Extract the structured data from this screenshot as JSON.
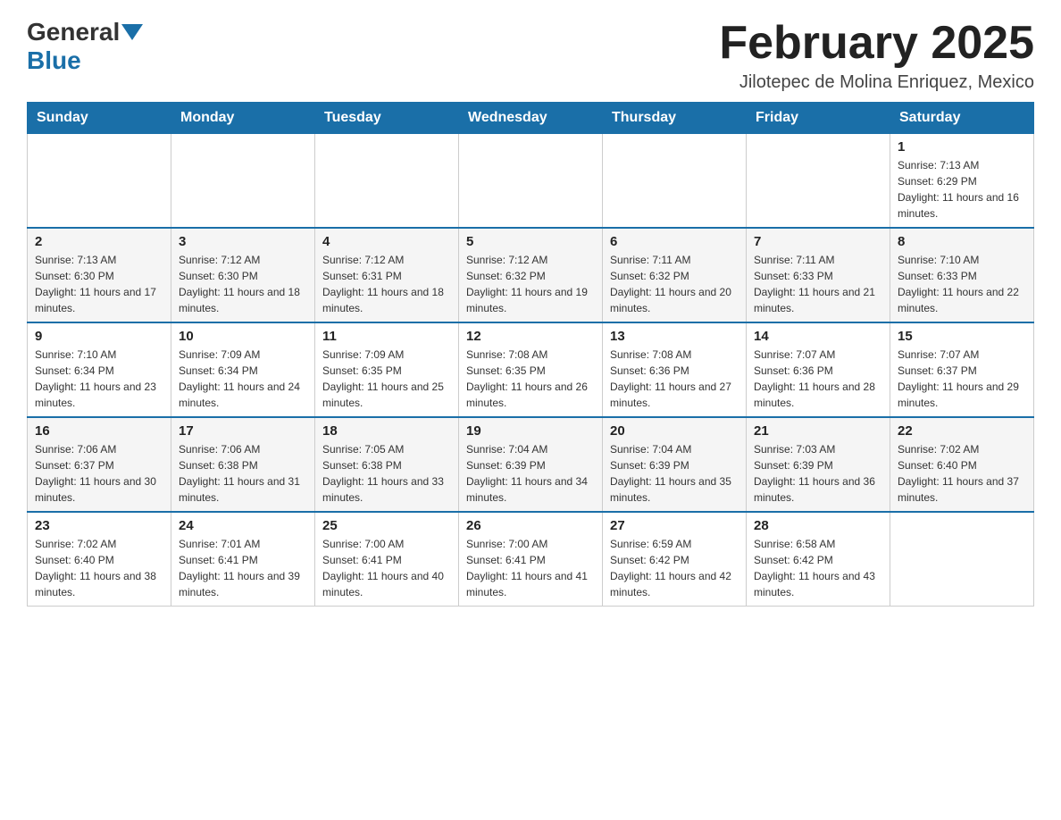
{
  "header": {
    "logo_general": "General",
    "logo_blue": "Blue",
    "month_title": "February 2025",
    "location": "Jilotepec de Molina Enriquez, Mexico"
  },
  "days_of_week": [
    "Sunday",
    "Monday",
    "Tuesday",
    "Wednesday",
    "Thursday",
    "Friday",
    "Saturday"
  ],
  "weeks": [
    [
      {
        "day": "",
        "info": ""
      },
      {
        "day": "",
        "info": ""
      },
      {
        "day": "",
        "info": ""
      },
      {
        "day": "",
        "info": ""
      },
      {
        "day": "",
        "info": ""
      },
      {
        "day": "",
        "info": ""
      },
      {
        "day": "1",
        "info": "Sunrise: 7:13 AM\nSunset: 6:29 PM\nDaylight: 11 hours and 16 minutes."
      }
    ],
    [
      {
        "day": "2",
        "info": "Sunrise: 7:13 AM\nSunset: 6:30 PM\nDaylight: 11 hours and 17 minutes."
      },
      {
        "day": "3",
        "info": "Sunrise: 7:12 AM\nSunset: 6:30 PM\nDaylight: 11 hours and 18 minutes."
      },
      {
        "day": "4",
        "info": "Sunrise: 7:12 AM\nSunset: 6:31 PM\nDaylight: 11 hours and 18 minutes."
      },
      {
        "day": "5",
        "info": "Sunrise: 7:12 AM\nSunset: 6:32 PM\nDaylight: 11 hours and 19 minutes."
      },
      {
        "day": "6",
        "info": "Sunrise: 7:11 AM\nSunset: 6:32 PM\nDaylight: 11 hours and 20 minutes."
      },
      {
        "day": "7",
        "info": "Sunrise: 7:11 AM\nSunset: 6:33 PM\nDaylight: 11 hours and 21 minutes."
      },
      {
        "day": "8",
        "info": "Sunrise: 7:10 AM\nSunset: 6:33 PM\nDaylight: 11 hours and 22 minutes."
      }
    ],
    [
      {
        "day": "9",
        "info": "Sunrise: 7:10 AM\nSunset: 6:34 PM\nDaylight: 11 hours and 23 minutes."
      },
      {
        "day": "10",
        "info": "Sunrise: 7:09 AM\nSunset: 6:34 PM\nDaylight: 11 hours and 24 minutes."
      },
      {
        "day": "11",
        "info": "Sunrise: 7:09 AM\nSunset: 6:35 PM\nDaylight: 11 hours and 25 minutes."
      },
      {
        "day": "12",
        "info": "Sunrise: 7:08 AM\nSunset: 6:35 PM\nDaylight: 11 hours and 26 minutes."
      },
      {
        "day": "13",
        "info": "Sunrise: 7:08 AM\nSunset: 6:36 PM\nDaylight: 11 hours and 27 minutes."
      },
      {
        "day": "14",
        "info": "Sunrise: 7:07 AM\nSunset: 6:36 PM\nDaylight: 11 hours and 28 minutes."
      },
      {
        "day": "15",
        "info": "Sunrise: 7:07 AM\nSunset: 6:37 PM\nDaylight: 11 hours and 29 minutes."
      }
    ],
    [
      {
        "day": "16",
        "info": "Sunrise: 7:06 AM\nSunset: 6:37 PM\nDaylight: 11 hours and 30 minutes."
      },
      {
        "day": "17",
        "info": "Sunrise: 7:06 AM\nSunset: 6:38 PM\nDaylight: 11 hours and 31 minutes."
      },
      {
        "day": "18",
        "info": "Sunrise: 7:05 AM\nSunset: 6:38 PM\nDaylight: 11 hours and 33 minutes."
      },
      {
        "day": "19",
        "info": "Sunrise: 7:04 AM\nSunset: 6:39 PM\nDaylight: 11 hours and 34 minutes."
      },
      {
        "day": "20",
        "info": "Sunrise: 7:04 AM\nSunset: 6:39 PM\nDaylight: 11 hours and 35 minutes."
      },
      {
        "day": "21",
        "info": "Sunrise: 7:03 AM\nSunset: 6:39 PM\nDaylight: 11 hours and 36 minutes."
      },
      {
        "day": "22",
        "info": "Sunrise: 7:02 AM\nSunset: 6:40 PM\nDaylight: 11 hours and 37 minutes."
      }
    ],
    [
      {
        "day": "23",
        "info": "Sunrise: 7:02 AM\nSunset: 6:40 PM\nDaylight: 11 hours and 38 minutes."
      },
      {
        "day": "24",
        "info": "Sunrise: 7:01 AM\nSunset: 6:41 PM\nDaylight: 11 hours and 39 minutes."
      },
      {
        "day": "25",
        "info": "Sunrise: 7:00 AM\nSunset: 6:41 PM\nDaylight: 11 hours and 40 minutes."
      },
      {
        "day": "26",
        "info": "Sunrise: 7:00 AM\nSunset: 6:41 PM\nDaylight: 11 hours and 41 minutes."
      },
      {
        "day": "27",
        "info": "Sunrise: 6:59 AM\nSunset: 6:42 PM\nDaylight: 11 hours and 42 minutes."
      },
      {
        "day": "28",
        "info": "Sunrise: 6:58 AM\nSunset: 6:42 PM\nDaylight: 11 hours and 43 minutes."
      },
      {
        "day": "",
        "info": ""
      }
    ]
  ]
}
